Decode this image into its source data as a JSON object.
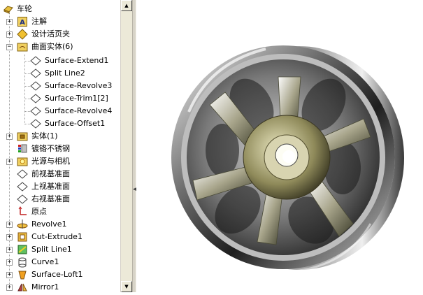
{
  "feature_tree": {
    "root": {
      "label": "车轮",
      "icon": "part-icon"
    },
    "items": [
      {
        "label": "注解",
        "icon": "annotations-icon",
        "expander": "+"
      },
      {
        "label": "设计活页夹",
        "icon": "design-binder-icon",
        "expander": "+"
      },
      {
        "label": "曲面实体(6)",
        "icon": "surface-bodies-folder-icon",
        "expander": "−",
        "children": [
          {
            "label": "Surface-Extend1",
            "icon": "surface-body-icon"
          },
          {
            "label": "Split Line2",
            "icon": "surface-body-icon"
          },
          {
            "label": "Surface-Revolve3",
            "icon": "surface-body-icon"
          },
          {
            "label": "Surface-Trim1[2]",
            "icon": "surface-body-icon"
          },
          {
            "label": "Surface-Revolve4",
            "icon": "surface-body-icon"
          },
          {
            "label": "Surface-Offset1",
            "icon": "surface-body-icon"
          }
        ]
      },
      {
        "label": "实体(1)",
        "icon": "solid-bodies-folder-icon",
        "expander": "+"
      },
      {
        "label": "镀铬不锈钢",
        "icon": "material-icon"
      },
      {
        "label": "光源与相机",
        "icon": "lights-cameras-icon",
        "expander": "+"
      },
      {
        "label": "前视基准面",
        "icon": "plane-icon"
      },
      {
        "label": "上视基准面",
        "icon": "plane-icon"
      },
      {
        "label": "右视基准面",
        "icon": "plane-icon"
      },
      {
        "label": "原点",
        "icon": "origin-icon"
      },
      {
        "label": "Revolve1",
        "icon": "revolve-icon",
        "expander": "+"
      },
      {
        "label": "Cut-Extrude1",
        "icon": "cut-extrude-icon",
        "expander": "+"
      },
      {
        "label": "Split Line1",
        "icon": "split-line-icon",
        "expander": "+"
      },
      {
        "label": "Curve1",
        "icon": "curve-icon",
        "expander": "+"
      },
      {
        "label": "Surface-Loft1",
        "icon": "surface-loft-icon",
        "expander": "+"
      },
      {
        "label": "Mirror1",
        "icon": "mirror-icon",
        "expander": "+"
      }
    ]
  },
  "scrollbar": {
    "up_arrow": "▲",
    "down_arrow": "▼"
  },
  "splitter": {
    "grip": "◂▸"
  },
  "model": {
    "description_icon": "wheel-model-icon"
  }
}
